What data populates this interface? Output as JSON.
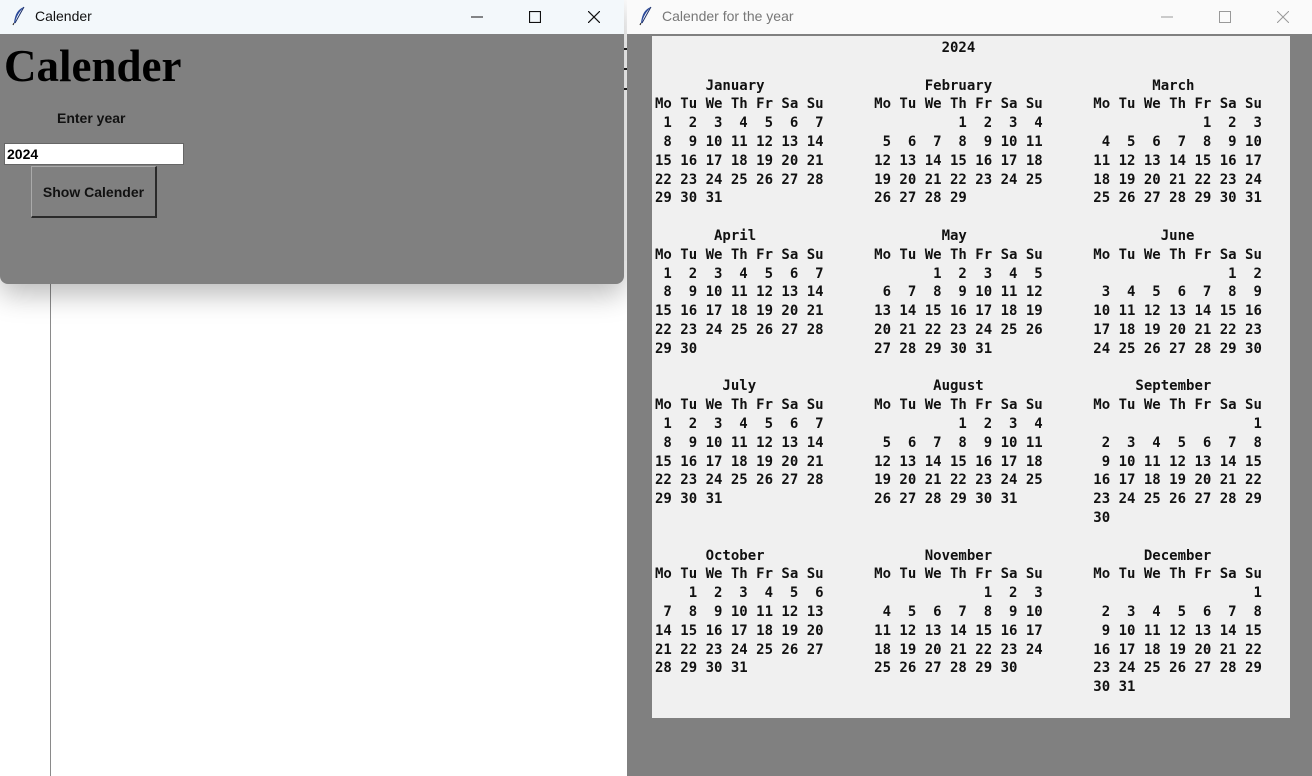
{
  "main_window": {
    "title": "Calender",
    "heading": "Calender",
    "year_label": "Enter year",
    "year_value": "2024",
    "show_button_label": "Show Calender"
  },
  "calendar_window": {
    "title": "Calender for the year",
    "calendar_text": "                                  2024\n\n      January                   February                   March\nMo Tu We Th Fr Sa Su      Mo Tu We Th Fr Sa Su      Mo Tu We Th Fr Sa Su\n 1  2  3  4  5  6  7                1  2  3  4                   1  2  3\n 8  9 10 11 12 13 14       5  6  7  8  9 10 11       4  5  6  7  8  9 10\n15 16 17 18 19 20 21      12 13 14 15 16 17 18      11 12 13 14 15 16 17\n22 23 24 25 26 27 28      19 20 21 22 23 24 25      18 19 20 21 22 23 24\n29 30 31                  26 27 28 29               25 26 27 28 29 30 31\n\n       April                      May                       June\nMo Tu We Th Fr Sa Su      Mo Tu We Th Fr Sa Su      Mo Tu We Th Fr Sa Su\n 1  2  3  4  5  6  7             1  2  3  4  5                      1  2\n 8  9 10 11 12 13 14       6  7  8  9 10 11 12       3  4  5  6  7  8  9\n15 16 17 18 19 20 21      13 14 15 16 17 18 19      10 11 12 13 14 15 16\n22 23 24 25 26 27 28      20 21 22 23 24 25 26      17 18 19 20 21 22 23\n29 30                     27 28 29 30 31            24 25 26 27 28 29 30\n\n        July                     August                  September\nMo Tu We Th Fr Sa Su      Mo Tu We Th Fr Sa Su      Mo Tu We Th Fr Sa Su\n 1  2  3  4  5  6  7                1  2  3  4                         1\n 8  9 10 11 12 13 14       5  6  7  8  9 10 11       2  3  4  5  6  7  8\n15 16 17 18 19 20 21      12 13 14 15 16 17 18       9 10 11 12 13 14 15\n22 23 24 25 26 27 28      19 20 21 22 23 24 25      16 17 18 19 20 21 22\n29 30 31                  26 27 28 29 30 31         23 24 25 26 27 28 29\n                                                    30\n\n      October                   November                  December\nMo Tu We Th Fr Sa Su      Mo Tu We Th Fr Sa Su      Mo Tu We Th Fr Sa Su\n    1  2  3  4  5  6                   1  2  3                         1\n 7  8  9 10 11 12 13       4  5  6  7  8  9 10       2  3  4  5  6  7  8\n14 15 16 17 18 19 20      11 12 13 14 15 16 17       9 10 11 12 13 14 15\n21 22 23 24 25 26 27      18 19 20 21 22 23 24      16 17 18 19 20 21 22\n28 29 30 31               25 26 27 28 29 30         23 24 25 26 27 28 29\n                                                    30 31"
  },
  "icons": {
    "app_icon": "feather-icon",
    "minimize": "minimize-icon",
    "maximize": "maximize-icon",
    "close": "close-icon"
  },
  "colors": {
    "window_bg": "#808080",
    "calendar_bg": "#f0f0f0",
    "main_titlebar": "#f3f8fb",
    "cal_titlebar": "#fafafa"
  }
}
